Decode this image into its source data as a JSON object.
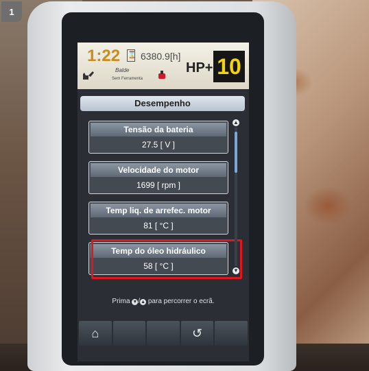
{
  "badge": "1",
  "status_bar": {
    "clock": "1:22",
    "hourglass_glyph": "⌛",
    "hour_meter": "6380.9[h]",
    "work_mode": "HP+",
    "power_level": "10",
    "attachment_name": "Balde",
    "attachment_sub": "Sem Ferramenta",
    "accent_color": "#f2d211"
  },
  "screen": {
    "title": "Desempenho",
    "items": [
      {
        "label": "Tensão da bateria",
        "value": "27.5 [ V ]"
      },
      {
        "label": "Velocidade do motor",
        "value": "1699 [ rpm ]"
      },
      {
        "label": "Temp liq. de arrefec. motor",
        "value": "81 [ °C ]"
      },
      {
        "label": "Temp do óleo hidráulico",
        "value": "58 [ °C ]"
      }
    ],
    "highlighted_color": "#e0181e",
    "hint_prefix": "Prima",
    "hint_icon_down": "▼",
    "hint_separator": "/",
    "hint_icon_up": "▲",
    "hint_suffix": "para percorrer o ecrã."
  },
  "softkeys": {
    "home_glyph": "⌂",
    "back_glyph": "↺",
    "icons": [
      "home-icon",
      "back-icon"
    ]
  }
}
